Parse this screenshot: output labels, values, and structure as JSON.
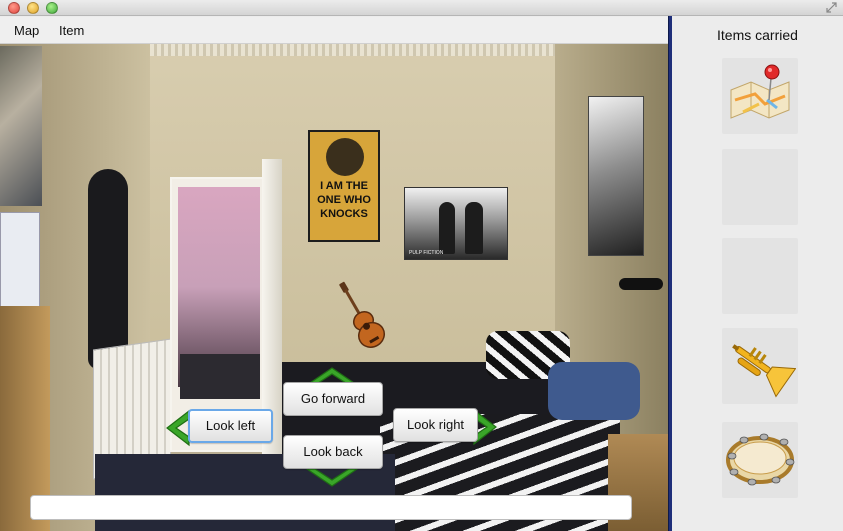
{
  "window": {
    "controls": [
      "close",
      "minimize",
      "zoom"
    ]
  },
  "menu": {
    "items": [
      {
        "label": "Map"
      },
      {
        "label": "Item"
      }
    ]
  },
  "scene": {
    "location": "bedroom",
    "poster_breaking_bad": {
      "line1": "I AM THE",
      "line2": "ONE WHO",
      "line3": "KNOCKS"
    },
    "poster_pulp_fiction": {
      "caption": "PULP FICTION"
    },
    "visible_item": "guitar-icon"
  },
  "navigation": {
    "forward_label": "Go forward",
    "left_label": "Look left",
    "right_label": "Look right",
    "back_label": "Look back"
  },
  "command_input": {
    "value": "",
    "placeholder": ""
  },
  "inventory": {
    "title": "Items carried",
    "slots": [
      {
        "item": "map-pin-icon"
      },
      {
        "item": ""
      },
      {
        "item": ""
      },
      {
        "item": "trumpet-icon"
      },
      {
        "item": "tambourine-icon"
      }
    ]
  },
  "colors": {
    "divider": "#1f2f7a",
    "arrow_green": "#3aa629",
    "focus_ring": "#6aa8e8"
  }
}
